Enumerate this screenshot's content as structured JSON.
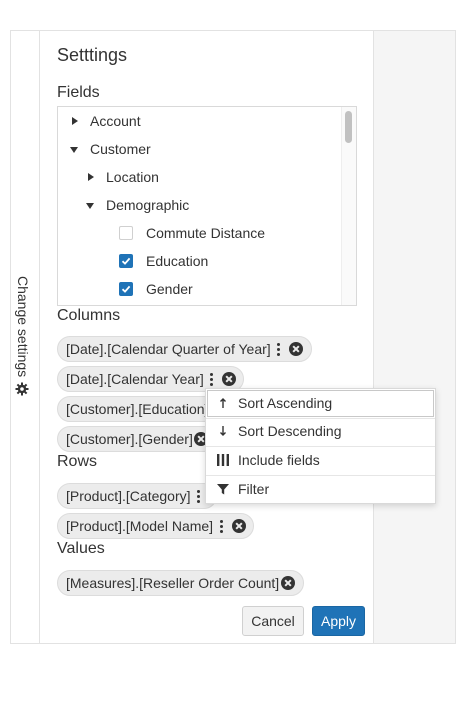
{
  "side_tab": {
    "label": "Change settings",
    "icon": "gear-icon"
  },
  "settings": {
    "title": "Setttings",
    "fields_label": "Fields",
    "tree": [
      {
        "label": "Account",
        "expanded": false
      },
      {
        "label": "Customer",
        "expanded": true
      },
      {
        "label": "Location",
        "expanded": false
      },
      {
        "label": "Demographic",
        "expanded": true
      },
      {
        "label": "Commute Distance",
        "checked": false
      },
      {
        "label": "Education",
        "checked": true
      },
      {
        "label": "Gender",
        "checked": true
      }
    ],
    "columns_label": "Columns",
    "columns": [
      "[Date].[Calendar Quarter of Year]",
      "[Date].[Calendar Year]",
      "[Customer].[Education]",
      "[Customer].[Gender]"
    ],
    "rows_label": "Rows",
    "rows": [
      "[Product].[Category]",
      "[Product].[Model Name]"
    ],
    "values_label": "Values",
    "values": [
      "[Measures].[Reseller Order Count]"
    ],
    "cancel_label": "Cancel",
    "apply_label": "Apply"
  },
  "context_menu": {
    "items": [
      {
        "label": "Sort Ascending",
        "icon": "arrow-up-icon"
      },
      {
        "label": "Sort Descending",
        "icon": "arrow-down-icon"
      },
      {
        "label": "Include fields",
        "icon": "columns-icon"
      },
      {
        "label": "Filter",
        "icon": "filter-icon"
      }
    ]
  },
  "colors": {
    "accent": "#1f73b7",
    "chip_bg": "#ececec",
    "panel_bg_right": "#f5f5f5"
  }
}
